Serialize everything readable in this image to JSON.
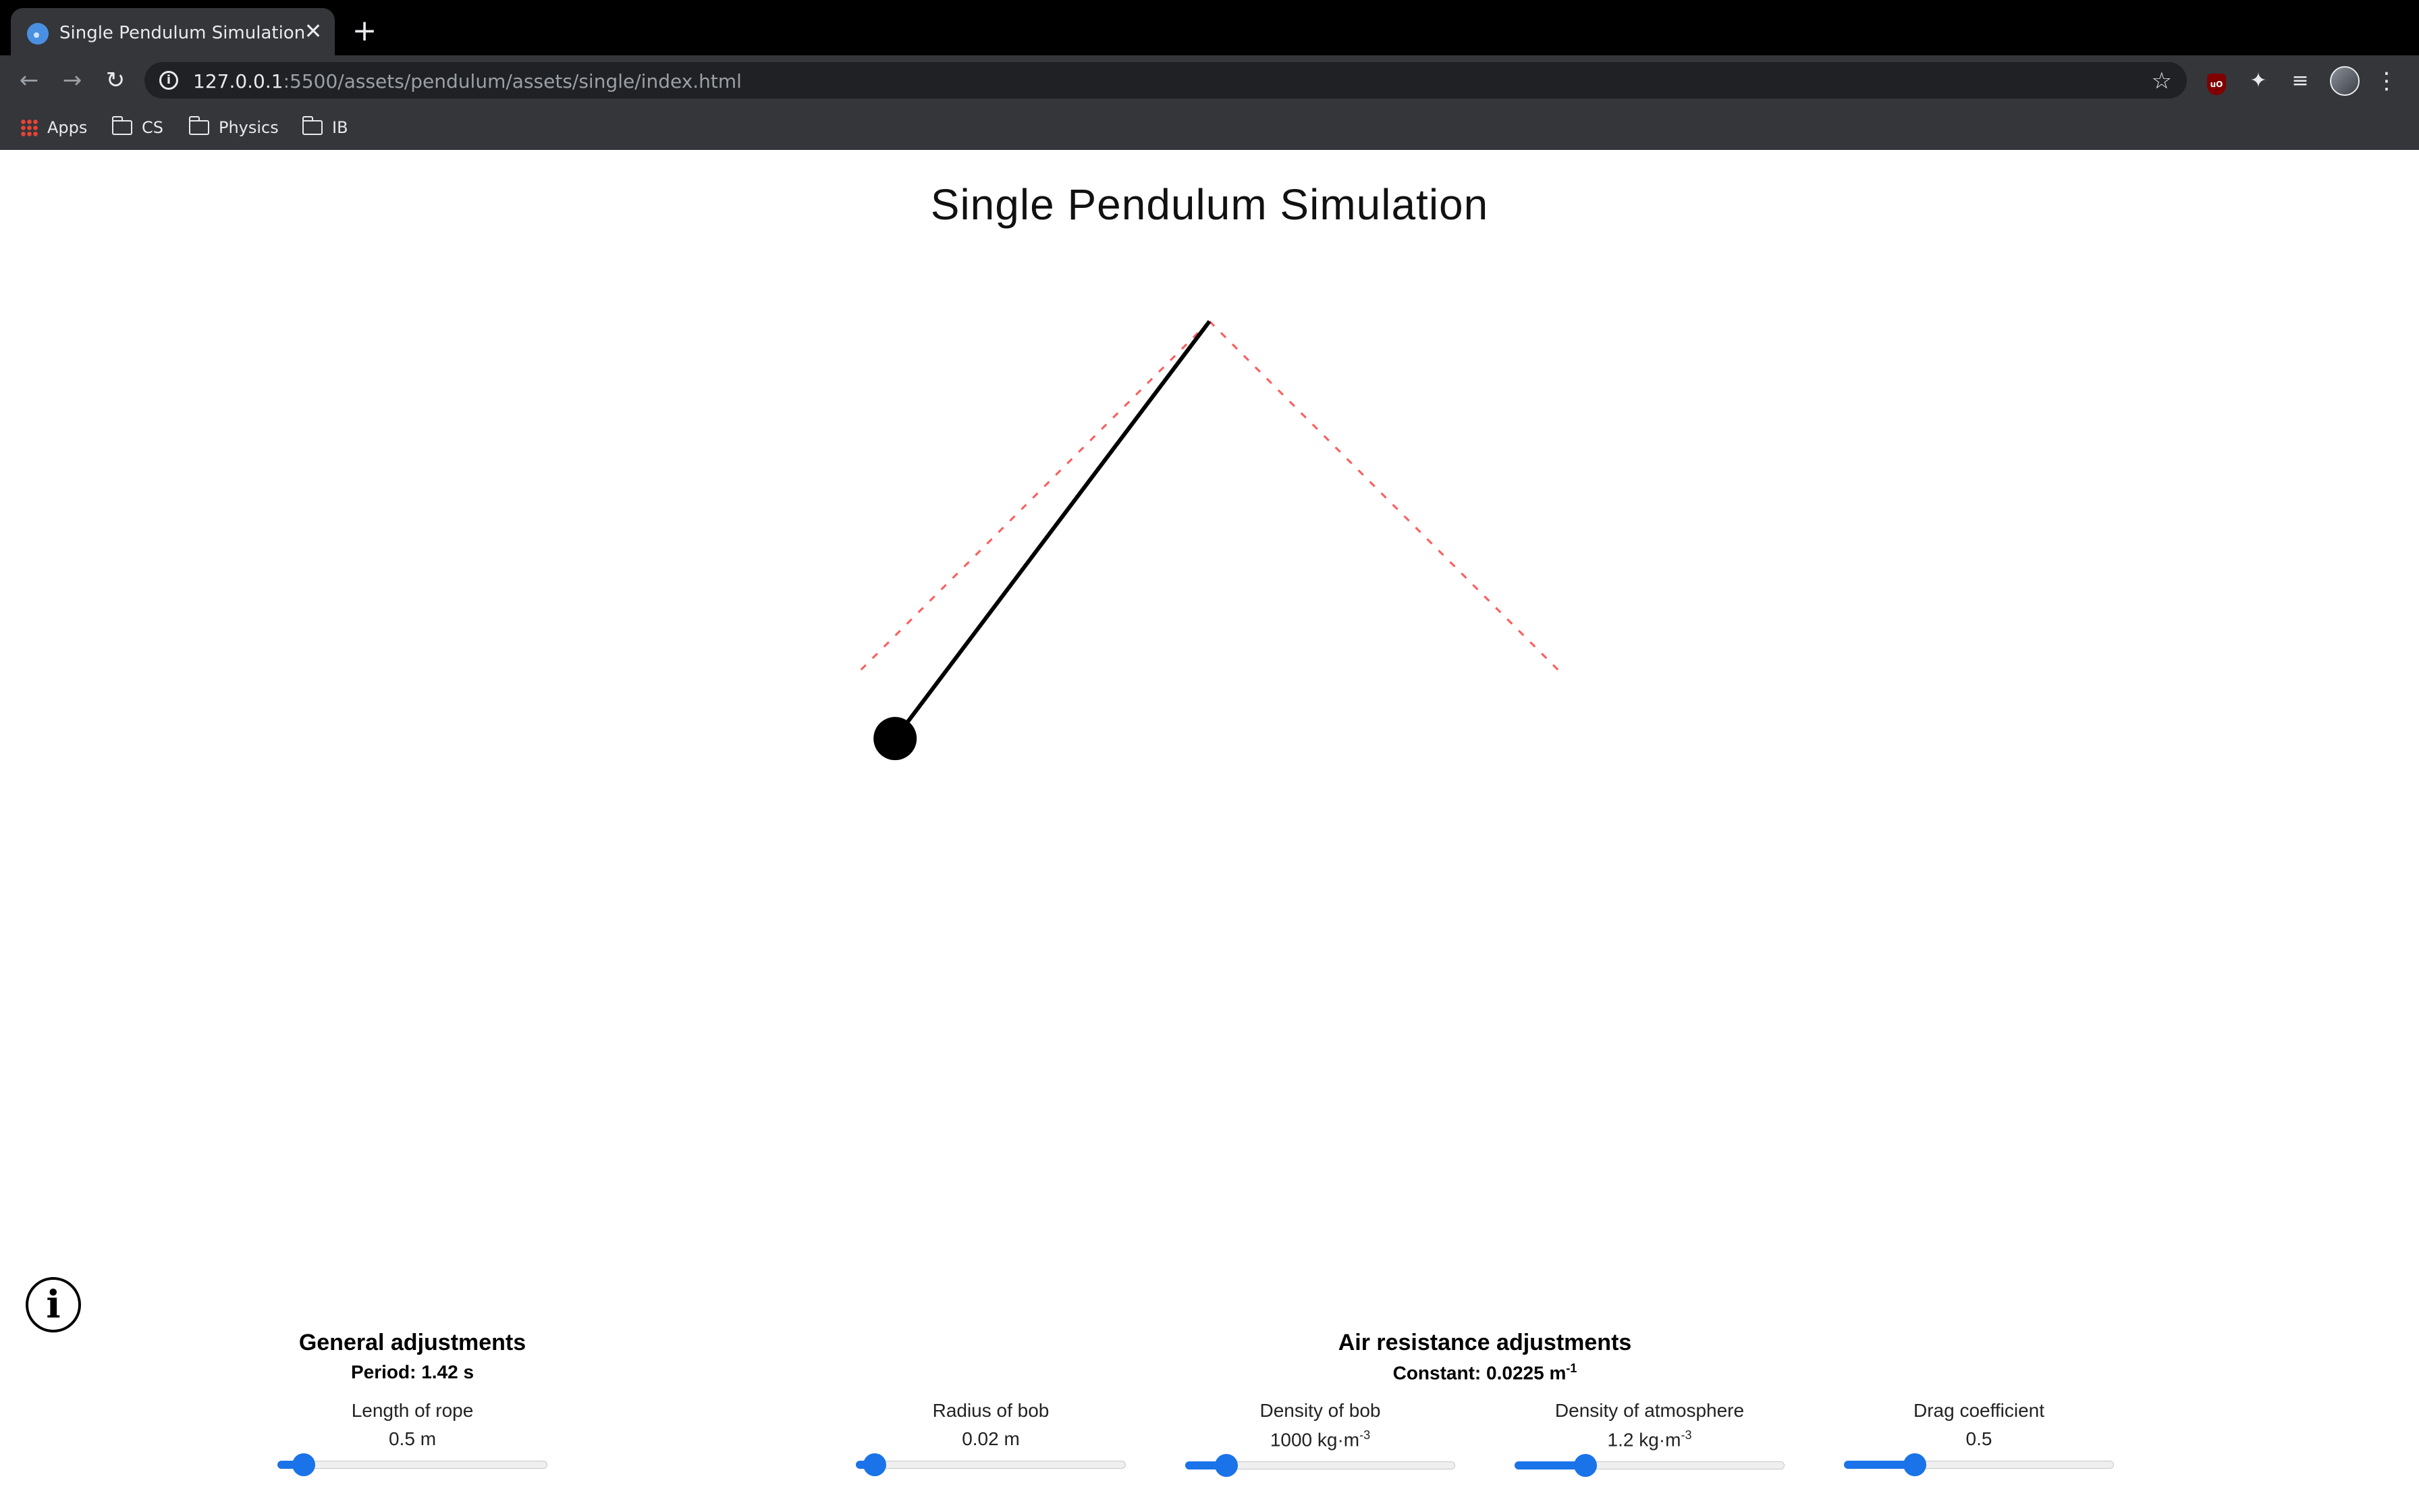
{
  "browser": {
    "tab_title": "Single Pendulum Simulation",
    "tab_close": "✕",
    "new_tab": "+",
    "url_host": "127.0.0.1",
    "url_rest": ":5500/assets/pendulum/assets/single/index.html",
    "bookmarks": [
      {
        "label": "Apps",
        "icon": "apps-grid-icon"
      },
      {
        "label": "CS",
        "icon": "folder-icon"
      },
      {
        "label": "Physics",
        "icon": "folder-icon"
      },
      {
        "label": "IB",
        "icon": "folder-icon"
      }
    ],
    "extension_ublock": "uO"
  },
  "page": {
    "title": "Single Pendulum Simulation"
  },
  "simulation": {
    "rope_length_m": 0.5,
    "current_angle_deg": -37,
    "amplitude_deg": 45,
    "bob_color": "#000000",
    "bound_color": "#ff5a5a"
  },
  "general": {
    "title": "General adjustments",
    "period": "Period: 1.42 s",
    "controls": [
      {
        "label": "Length of rope",
        "value": "0.5 m",
        "fraction": 0.06
      }
    ]
  },
  "air": {
    "title": "Air resistance adjustments",
    "constant": "Constant: 0.0225 m",
    "constant_sup": "-1",
    "controls": [
      {
        "label": "Radius of bob",
        "value": "0.02 m",
        "fraction": 0.03
      },
      {
        "label": "Density of bob",
        "value": "1000 kg·m",
        "sup": "-3",
        "fraction": 0.12
      },
      {
        "label": "Density of atmosphere",
        "value": "1.2 kg·m",
        "sup": "-3",
        "fraction": 0.24
      },
      {
        "label": "Drag coefficient",
        "value": "0.5",
        "fraction": 0.24
      }
    ]
  },
  "accent_color": "#1a73e8"
}
